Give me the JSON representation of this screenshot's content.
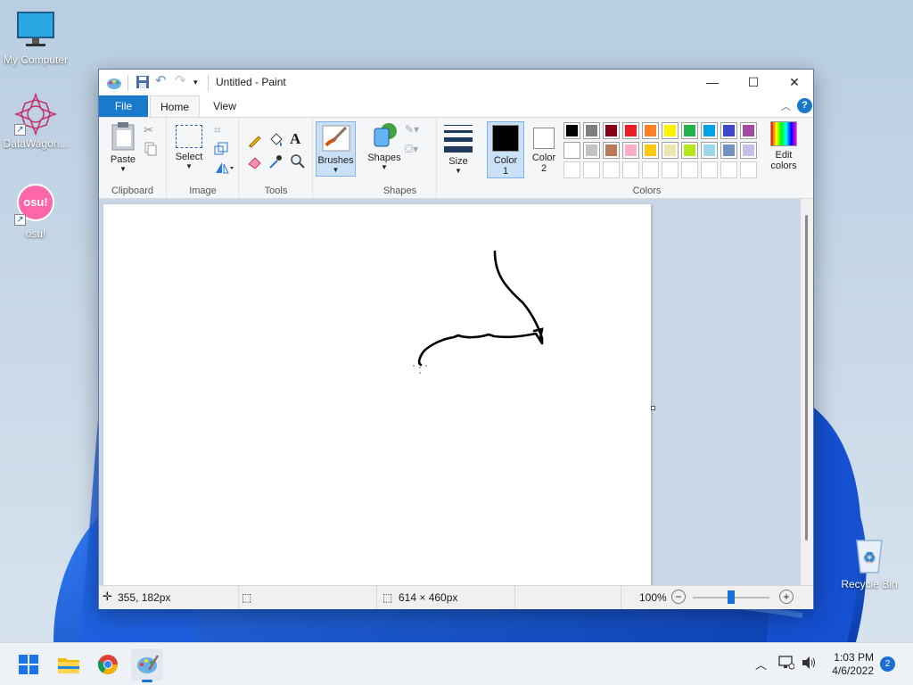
{
  "desktop": {
    "icons": [
      {
        "label": "My Computer"
      },
      {
        "label": "DataWagon..."
      },
      {
        "label": "osu!"
      },
      {
        "label": "Recycle Bin"
      }
    ],
    "osu_icon_text": "osu!"
  },
  "window": {
    "title": "Untitled - Paint",
    "controls": {
      "minimize": "—",
      "maximize": "☐",
      "close": "✕"
    }
  },
  "ribbon": {
    "tabs": [
      "File",
      "Home",
      "View"
    ],
    "active_tab": "Home",
    "help": "?",
    "clipboard": {
      "paste_label": "Paste",
      "group_label": "Clipboard"
    },
    "image": {
      "select_label": "Select",
      "group_label": "Image"
    },
    "tools": {
      "group_label": "Tools",
      "text_tool": "A"
    },
    "brushes": {
      "label": "Brushes"
    },
    "shapes": {
      "label": "Shapes",
      "group_label": "Shapes"
    },
    "size": {
      "label": "Size"
    },
    "colors": {
      "color1_label": "Color",
      "color1_num": "1",
      "color2_label": "Color",
      "color2_num": "2",
      "edit_colors_line1": "Edit",
      "edit_colors_line2": "colors",
      "group_label": "Colors",
      "color1": "#000000",
      "color2": "#ffffff",
      "palette_row1": [
        "#000000",
        "#7f7f7f",
        "#880015",
        "#ed1c24",
        "#ff7f27",
        "#fff200",
        "#22b14c",
        "#00a2e8",
        "#3f48cc",
        "#a349a4"
      ],
      "palette_row2": [
        "#ffffff",
        "#c3c3c3",
        "#b97a57",
        "#ffaec9",
        "#ffc90e",
        "#efe4b0",
        "#b5e61d",
        "#99d9ea",
        "#7092be",
        "#c8bfe7"
      ]
    }
  },
  "status": {
    "cursor_pos": "355, 182px",
    "canvas_size": "614 × 460px",
    "zoom": "100%",
    "zoom_fraction": 0.5
  },
  "taskbar": {
    "time": "1:03 PM",
    "date": "4/6/2022",
    "notifications": "2"
  }
}
